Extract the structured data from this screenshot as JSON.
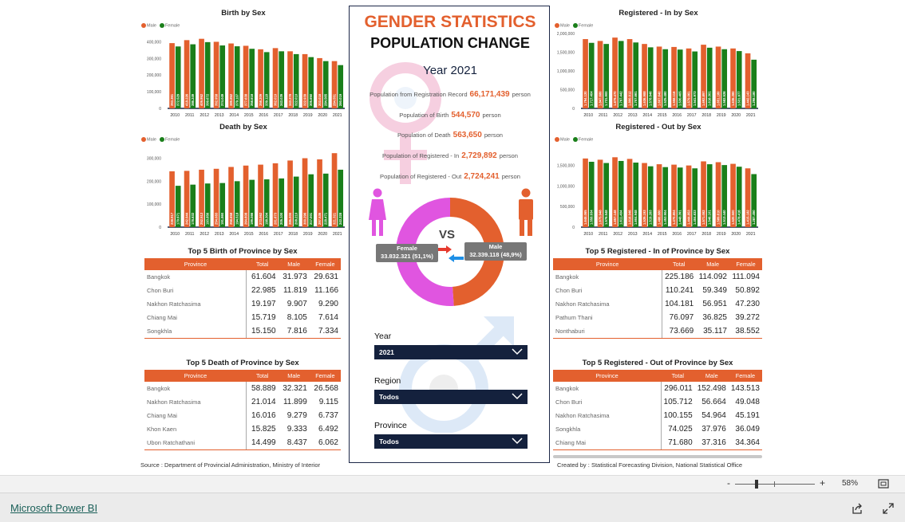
{
  "colors": {
    "male": "#e3602e",
    "female": "#1a7f1a",
    "female_donut": "#e055e0",
    "navy": "#14213d"
  },
  "legend": {
    "male": "Male",
    "female": "Female"
  },
  "charts": {
    "birth": {
      "title": "Birth by Sex",
      "years": [
        "2010",
        "2011",
        "2012",
        "2013",
        "2014",
        "2015",
        "2016",
        "2017",
        "2018",
        "2019",
        "2020",
        "2021"
      ],
      "male": [
        392000,
        410000,
        418000,
        400000,
        390000,
        376000,
        355000,
        362000,
        343000,
        326000,
        302000,
        284000
      ],
      "female": [
        372000,
        385000,
        398000,
        378000,
        373000,
        358000,
        338000,
        343000,
        326000,
        308000,
        284000,
        260000
      ],
      "male_labels": [
        "393.361",
        "418.226",
        "409.952",
        "392.958",
        "389.852",
        "377.638",
        "358.209",
        "362.010",
        "343.278",
        "322.939",
        "303.016",
        "284.551"
      ],
      "female_labels": [
        "372.529",
        "386.249",
        "399.672",
        "374.049",
        "379.107",
        "358.616",
        "339.118",
        "343.039",
        "322.010",
        "305.650",
        "284.565",
        "260.019"
      ],
      "yticks": [
        "0",
        "100,000",
        "200,000",
        "300,000",
        "400,000"
      ],
      "ymax": 450000
    },
    "death": {
      "title": "Death by Sex",
      "years": [
        "2010",
        "2011",
        "2012",
        "2013",
        "2014",
        "2015",
        "2016",
        "2017",
        "2018",
        "2019",
        "2020",
        "2021"
      ],
      "male": [
        243000,
        245000,
        250000,
        254000,
        262000,
        268000,
        272000,
        278000,
        290000,
        300000,
        295000,
        322000
      ],
      "female": [
        180000,
        185000,
        190000,
        192000,
        200000,
        206000,
        208000,
        212000,
        220000,
        230000,
        233000,
        250000
      ],
      "male_labels": [
        "238.917",
        "242.944",
        "252.513",
        "254.083",
        "258.658",
        "264.608",
        "273.062",
        "281.673",
        "285.000",
        "300.296",
        "297.536",
        "321.321"
      ],
      "female_labels": [
        "179.971",
        "178.832",
        "193.856",
        "191.860",
        "194.518",
        "199.066",
        "198.304",
        "205.100",
        "208.210",
        "217.001",
        "228.471",
        "243.328"
      ],
      "yticks": [
        "0",
        "100,000",
        "200,000",
        "300,000"
      ],
      "ymax": 340000
    },
    "reg_in": {
      "title": "Registered - In by Sex",
      "years": [
        "2010",
        "2011",
        "2012",
        "2013",
        "2014",
        "2015",
        "2016",
        "2017",
        "2018",
        "2019",
        "2020",
        "2021"
      ],
      "male": [
        1850000,
        1800000,
        1890000,
        1850000,
        1720000,
        1650000,
        1640000,
        1600000,
        1700000,
        1650000,
        1600000,
        1470000
      ],
      "female": [
        1750000,
        1720000,
        1800000,
        1760000,
        1630000,
        1580000,
        1570000,
        1520000,
        1620000,
        1580000,
        1530000,
        1300000
      ],
      "male_labels": [
        "1.794.120",
        "1.847.680",
        "1.879.470",
        "1.800.912",
        "1.636.988",
        "1.607.640",
        "1.558.116",
        "1.579.061",
        "1.692.897",
        "1.651.180",
        "1.636.380",
        "1.442.143"
      ],
      "female_labels": [
        "1.717.404",
        "1.731.900",
        "1.797.442",
        "1.707.661",
        "1.578.946",
        "1.525.480",
        "1.530.405",
        "1.541.973",
        "1.616.301",
        "1.582.526",
        "1.531.977",
        "1.298.180"
      ],
      "yticks": [
        "0",
        "500,000",
        "1,000,000",
        "1,500,000",
        "2,000,000"
      ],
      "ymax": 2000000
    },
    "reg_out": {
      "title": "Registered - Out by Sex",
      "years": [
        "2010",
        "2011",
        "2012",
        "2013",
        "2014",
        "2015",
        "2016",
        "2017",
        "2018",
        "2019",
        "2020",
        "2021"
      ],
      "male": [
        1670000,
        1640000,
        1700000,
        1660000,
        1560000,
        1530000,
        1520000,
        1500000,
        1600000,
        1580000,
        1540000,
        1430000
      ],
      "female": [
        1590000,
        1560000,
        1610000,
        1570000,
        1480000,
        1460000,
        1450000,
        1430000,
        1530000,
        1510000,
        1470000,
        1290000
      ],
      "male_labels": [
        "1.648.065",
        "1.675.948",
        "1.657.148",
        "1.616.946",
        "1.539.193",
        "1.486.880",
        "1.470.804",
        "1.444.853",
        "1.571.082",
        "1.589.810",
        "1.520.500",
        "1.415.182"
      ],
      "female_labels": [
        "1.558.934",
        "1.576.548",
        "1.611.404",
        "1.604.948",
        "1.519.283",
        "1.453.904",
        "1.448.391",
        "1.404.833",
        "1.546.101",
        "1.513.440",
        "1.478.416",
        "1.287.450"
      ],
      "yticks": [
        "0",
        "500,000",
        "1,000,000",
        "1,500,000"
      ],
      "ymax": 1900000
    }
  },
  "center": {
    "title1": "GENDER STATISTICS",
    "title2": "POPULATION CHANGE",
    "year_label": "Year",
    "year_value": "2021",
    "stats": [
      {
        "label": "Population from Registration Record",
        "value": "66,171,439",
        "unit": "person"
      },
      {
        "label": "Population of Birth",
        "value": "544,570",
        "unit": "person"
      },
      {
        "label": "Population of Death",
        "value": "563,650",
        "unit": "person"
      },
      {
        "label": "Population of Registered - In",
        "value": "2,729,892",
        "unit": "person"
      },
      {
        "label": "Population of Registered - Out",
        "value": "2,724,241",
        "unit": "person"
      }
    ],
    "donut": {
      "vs": "VS",
      "female_label": "Female",
      "female_value": "33.832.321 (51,1%)",
      "female_pct": 51.1,
      "male_label": "Male",
      "male_value": "32.339.118 (48,9%)",
      "male_pct": 48.9
    },
    "slicers": [
      {
        "label": "Year",
        "value": "2021"
      },
      {
        "label": "Region",
        "value": "Todos"
      },
      {
        "label": "Province",
        "value": "Todos"
      }
    ]
  },
  "tables": {
    "headers": [
      "Province",
      "Total",
      "Male",
      "Female"
    ],
    "top_birth": {
      "title": "Top 5 Birth of Province by Sex",
      "rows": [
        [
          "Bangkok",
          "61.604",
          "31.973",
          "29.631"
        ],
        [
          "Chon Buri",
          "22.985",
          "11.819",
          "11.166"
        ],
        [
          "Nakhon Ratchasima",
          "19.197",
          "9.907",
          "9.290"
        ],
        [
          "Chiang Mai",
          "15.719",
          "8.105",
          "7.614"
        ],
        [
          "Songkhla",
          "15.150",
          "7.816",
          "7.334"
        ]
      ]
    },
    "top_death": {
      "title": "Top 5 Death of Province by Sex",
      "rows": [
        [
          "Bangkok",
          "58.889",
          "32.321",
          "26.568"
        ],
        [
          "Nakhon Ratchasima",
          "21.014",
          "11.899",
          "9.115"
        ],
        [
          "Chiang Mai",
          "16.016",
          "9.279",
          "6.737"
        ],
        [
          "Khon Kaen",
          "15.825",
          "9.333",
          "6.492"
        ],
        [
          "Ubon Ratchathani",
          "14.499",
          "8.437",
          "6.062"
        ]
      ]
    },
    "top_reg_in": {
      "title": "Top 5 Registered - In of Province by Sex",
      "rows": [
        [
          "Bangkok",
          "225.186",
          "114.092",
          "111.094"
        ],
        [
          "Chon Buri",
          "110.241",
          "59.349",
          "50.892"
        ],
        [
          "Nakhon Ratchasima",
          "104.181",
          "56.951",
          "47.230"
        ],
        [
          "Pathum Thani",
          "76.097",
          "36.825",
          "39.272"
        ],
        [
          "Nonthaburi",
          "73.669",
          "35.117",
          "38.552"
        ]
      ]
    },
    "top_reg_out": {
      "title": "Top 5 Registered - Out of Province by Sex",
      "rows": [
        [
          "Bangkok",
          "296.011",
          "152.498",
          "143.513"
        ],
        [
          "Chon Buri",
          "105.712",
          "56.664",
          "49.048"
        ],
        [
          "Nakhon Ratchasima",
          "100.155",
          "54.964",
          "45.191"
        ],
        [
          "Songkhla",
          "74.025",
          "37.976",
          "36.049"
        ],
        [
          "Chiang Mai",
          "71.680",
          "37.316",
          "34.364"
        ]
      ]
    }
  },
  "footer": {
    "source": "Source : Department of Provincial Administration, Ministry of Interior",
    "created": "Created by : Statistical Forecasting Division, National Statistical Office"
  },
  "zoom": {
    "minus": "-",
    "plus": "+",
    "value": "58%",
    "level": 0.58
  },
  "powerbi": {
    "link": "Microsoft Power BI"
  }
}
